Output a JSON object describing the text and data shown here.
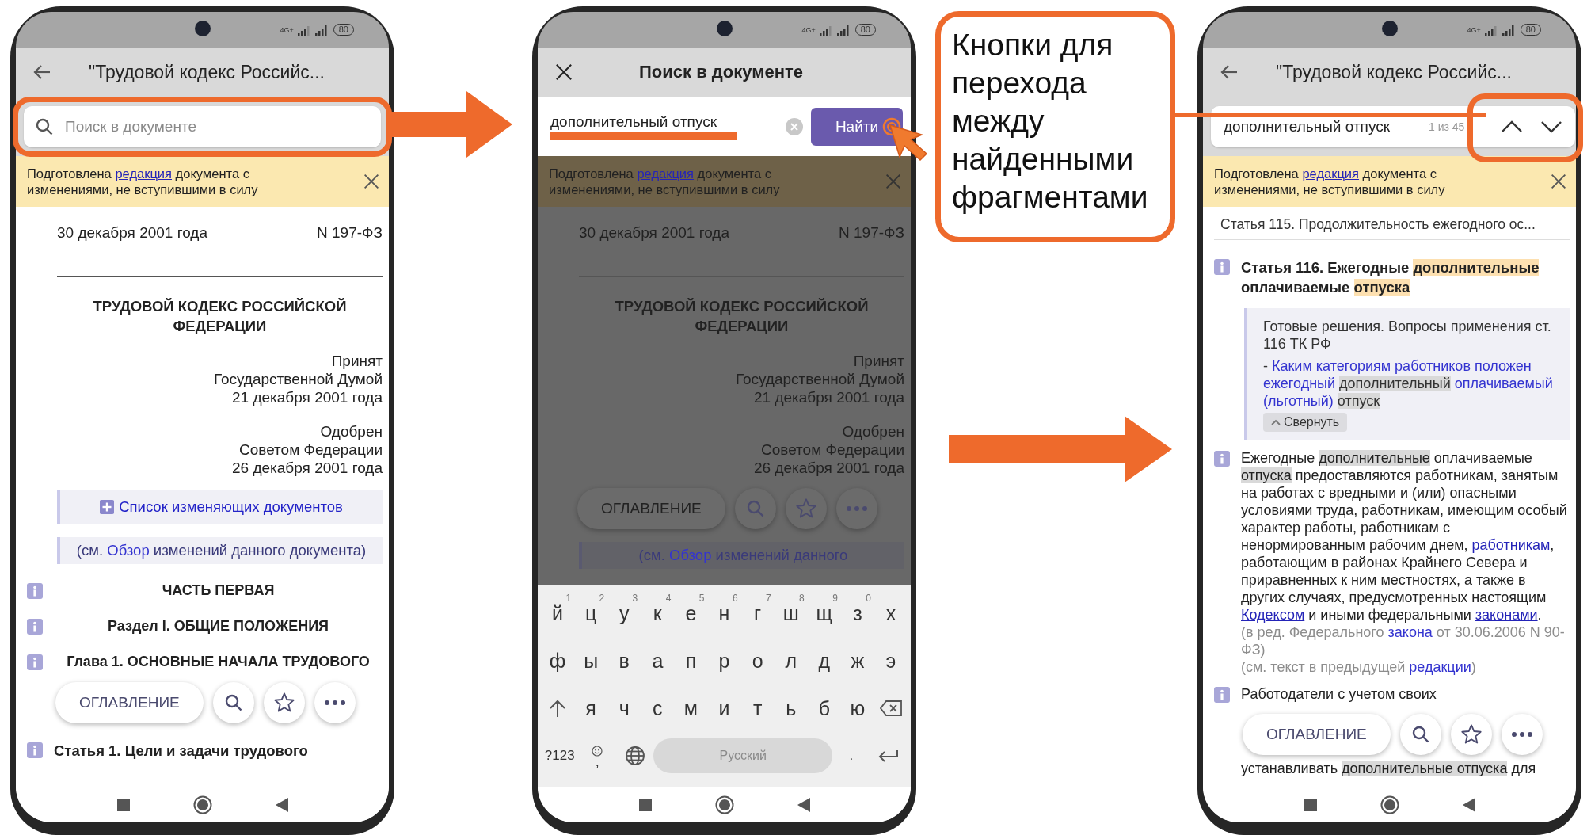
{
  "panels": [
    {
      "kind": "phone",
      "status": {
        "network": "4G+",
        "battery": "80"
      },
      "app_bar": {
        "kind": "back",
        "title": "\"Трудовой кодекс Российс..."
      },
      "search": {
        "kind": "placeholder",
        "placeholder": "Поиск в документе",
        "highlighted": true
      },
      "banner": [
        {
          "kind": "text",
          "text": "Подготовлена "
        },
        {
          "kind": "link",
          "text": "редакция"
        },
        {
          "kind": "text",
          "text": " документа с изменениями, не вступившими в силу"
        }
      ],
      "dimmed": false,
      "blocks": [
        {
          "kind": "date_row",
          "left": "30 декабря 2001 года",
          "right": "N 197-ФЗ"
        },
        {
          "kind": "rule"
        },
        {
          "kind": "title",
          "text": "ТРУДОВОЙ КОДЕКС РОССИЙСКОЙ ФЕДЕРАЦИИ"
        },
        {
          "kind": "right",
          "lines": [
            "Принят",
            "Государственной Думой",
            "21 декабря 2001 года"
          ]
        },
        {
          "kind": "right",
          "lines": [
            "Одобрен",
            "Советом Федерации",
            "26 декабря 2001 года"
          ]
        },
        {
          "kind": "changes",
          "text": "Список изменяющих документов"
        },
        {
          "kind": "note",
          "segments": [
            {
              "kind": "text",
              "text": "(см. "
            },
            {
              "kind": "link2",
              "text": "Обзор"
            },
            {
              "kind": "text",
              "text": " изменений данного документа)"
            }
          ]
        },
        {
          "kind": "heading",
          "info": true,
          "text": "ЧАСТЬ ПЕРВАЯ"
        },
        {
          "kind": "heading",
          "info": true,
          "text": "Раздел I. ОБЩИЕ ПОЛОЖЕНИЯ"
        },
        {
          "kind": "heading",
          "info": true,
          "text": "Глава 1. ОСНОВНЫЕ НАЧАЛА ТРУДОВОГО"
        },
        {
          "kind": "toolbar",
          "label": "ОГЛАВЛЕНИЕ"
        },
        {
          "kind": "heading_left",
          "info": true,
          "segments": [
            {
              "kind": "text",
              "text": "Статья 1. Цели и задачи трудового"
            }
          ]
        }
      ]
    },
    {
      "kind": "phone",
      "status": {
        "network": "4G+",
        "battery": "80"
      },
      "app_bar": {
        "kind": "close",
        "title": "Поиск в документе"
      },
      "search": {
        "kind": "entry",
        "value": "дополнительный отпуск",
        "underlined": true,
        "button": "Найти",
        "tapped": true
      },
      "banner": [
        {
          "kind": "text",
          "text": "Подготовлена "
        },
        {
          "kind": "link",
          "text": "редакция"
        },
        {
          "kind": "text",
          "text": " документа с изменениями, не вступившими в силу"
        }
      ],
      "dimmed": true,
      "blocks": [
        {
          "kind": "date_row",
          "left": "30 декабря 2001 года",
          "right": "N 197-ФЗ"
        },
        {
          "kind": "rule"
        },
        {
          "kind": "title",
          "text": "ТРУДОВОЙ КОДЕКС РОССИЙСКОЙ ФЕДЕРАЦИИ"
        },
        {
          "kind": "right",
          "lines": [
            "Принят",
            "Государственной Думой",
            "21 декабря 2001 года"
          ]
        },
        {
          "kind": "right",
          "lines": [
            "Одобрен",
            "Советом Федерации",
            "26 декабря 2001 года"
          ]
        },
        {
          "kind": "toolbar",
          "label": "ОГЛАВЛЕНИЕ"
        },
        {
          "kind": "note",
          "segments": [
            {
              "kind": "text",
              "text": "(см. "
            },
            {
              "kind": "link2",
              "text": "Обзор"
            },
            {
              "kind": "text",
              "text": " изменений данного"
            }
          ]
        }
      ],
      "keyboard": [
        [
          {
            "kind": "letter",
            "label": "й",
            "hint": "1"
          },
          {
            "kind": "letter",
            "label": "ц",
            "hint": "2"
          },
          {
            "kind": "letter",
            "label": "у",
            "hint": "3"
          },
          {
            "kind": "letter",
            "label": "к",
            "hint": "4"
          },
          {
            "kind": "letter",
            "label": "е",
            "hint": "5"
          },
          {
            "kind": "letter",
            "label": "н",
            "hint": "6"
          },
          {
            "kind": "letter",
            "label": "г",
            "hint": "7"
          },
          {
            "kind": "letter",
            "label": "ш",
            "hint": "8"
          },
          {
            "kind": "letter",
            "label": "щ",
            "hint": "9"
          },
          {
            "kind": "letter",
            "label": "з",
            "hint": "0"
          },
          {
            "kind": "letter",
            "label": "х"
          }
        ],
        [
          {
            "kind": "letter",
            "label": "ф"
          },
          {
            "kind": "letter",
            "label": "ы"
          },
          {
            "kind": "letter",
            "label": "в"
          },
          {
            "kind": "letter",
            "label": "а"
          },
          {
            "kind": "letter",
            "label": "п"
          },
          {
            "kind": "letter",
            "label": "р"
          },
          {
            "kind": "letter",
            "label": "о"
          },
          {
            "kind": "letter",
            "label": "л"
          },
          {
            "kind": "letter",
            "label": "д"
          },
          {
            "kind": "letter",
            "label": "ж"
          },
          {
            "kind": "letter",
            "label": "э"
          }
        ],
        [
          {
            "kind": "shift"
          },
          {
            "kind": "letter",
            "label": "я"
          },
          {
            "kind": "letter",
            "label": "ч"
          },
          {
            "kind": "letter",
            "label": "с"
          },
          {
            "kind": "letter",
            "label": "м"
          },
          {
            "kind": "letter",
            "label": "и"
          },
          {
            "kind": "letter",
            "label": "т"
          },
          {
            "kind": "letter",
            "label": "ь"
          },
          {
            "kind": "letter",
            "label": "б"
          },
          {
            "kind": "letter",
            "label": "ю"
          },
          {
            "kind": "backspace"
          }
        ],
        [
          {
            "kind": "key",
            "label": "?123"
          },
          {
            "kind": "emoji",
            "label": ","
          },
          {
            "kind": "globe"
          },
          {
            "kind": "space",
            "label": "Русский"
          },
          {
            "kind": "key",
            "label": "."
          },
          {
            "kind": "enter"
          }
        ]
      ]
    },
    {
      "kind": "callout",
      "text": "Кнопки для перехода между найденными фрагментами"
    },
    {
      "kind": "phone",
      "status": {
        "network": "4G+",
        "battery": "80"
      },
      "app_bar": {
        "kind": "back",
        "title": "\"Трудовой кодекс Российс..."
      },
      "search": {
        "kind": "results",
        "value": "дополнительный отпуск",
        "counter": "1 из 45",
        "highlighted": true
      },
      "banner": [
        {
          "kind": "text",
          "text": "Подготовлена "
        },
        {
          "kind": "link",
          "text": "редакция"
        },
        {
          "kind": "text",
          "text": " документа с изменениями, не вступившими в силу"
        }
      ],
      "dimmed": false,
      "blocks": [
        {
          "kind": "cut_row",
          "text": "Статья 115. Продолжительность ежегодного ос..."
        },
        {
          "kind": "heading_left",
          "info": true,
          "segments": [
            {
              "kind": "text",
              "text": "Статья 116. Ежегодные "
            },
            {
              "kind": "current",
              "text": "дополнительные"
            },
            {
              "kind": "text",
              "text": " оплачиваемые "
            },
            {
              "kind": "current",
              "text": "отпуска"
            }
          ]
        },
        {
          "kind": "collapse",
          "title": "Готовые решения. Вопросы применения ст. 116 ТК РФ",
          "link": [
            {
              "kind": "text",
              "text": "- "
            },
            {
              "kind": "link2",
              "text": "Каким категориям работников положен ежегодный "
            },
            {
              "kind": "link_hit",
              "text": "дополнительный"
            },
            {
              "kind": "link2",
              "text": " оплачиваемый (льготный) "
            },
            {
              "kind": "link_hit",
              "text": "отпуск"
            }
          ],
          "button": "Свернуть"
        },
        {
          "kind": "para",
          "info": true,
          "segments": [
            {
              "kind": "text",
              "text": "Ежегодные "
            },
            {
              "kind": "hit",
              "text": "дополнительные"
            },
            {
              "kind": "text",
              "text": " оплачиваемые "
            },
            {
              "kind": "hit",
              "text": "отпуска"
            },
            {
              "kind": "text",
              "text": " предоставляются работникам, занятым на работах с вредными и (или) опасными условиями труда, работникам, имеющим особый характер работы, работникам с ненормированным рабочим днем, "
            },
            {
              "kind": "link",
              "text": "работникам"
            },
            {
              "kind": "text",
              "text": ", работающим в районах Крайнего Севера и приравненных к ним местностях, а также в других случаях, предусмотренных настоящим "
            },
            {
              "kind": "link",
              "text": "Кодексом"
            },
            {
              "kind": "text",
              "text": " и иными федеральными "
            },
            {
              "kind": "link",
              "text": "законами"
            },
            {
              "kind": "text",
              "text": "."
            }
          ]
        },
        {
          "kind": "para",
          "info": false,
          "segments": [
            {
              "kind": "muted",
              "text": "(в ред. Федерального "
            },
            {
              "kind": "link2",
              "text": "закона"
            },
            {
              "kind": "muted",
              "text": " от 30.06.2006 N 90-ФЗ)"
            }
          ]
        },
        {
          "kind": "para",
          "info": false,
          "segments": [
            {
              "kind": "muted",
              "text": "(см. текст в предыдущей "
            },
            {
              "kind": "link2",
              "text": "редакции"
            },
            {
              "kind": "muted",
              "text": ")"
            }
          ]
        },
        {
          "kind": "para",
          "info": true,
          "segments": [
            {
              "kind": "text",
              "text": "Работодатели с учетом своих"
            }
          ]
        },
        {
          "kind": "toolbar",
          "label": "ОГЛАВЛЕНИЕ"
        },
        {
          "kind": "para",
          "info": false,
          "segments": [
            {
              "kind": "text",
              "text": "устанавливать "
            },
            {
              "kind": "hit",
              "text": "дополнительные отпуска"
            },
            {
              "kind": "text",
              "text": " для"
            }
          ]
        }
      ]
    }
  ]
}
